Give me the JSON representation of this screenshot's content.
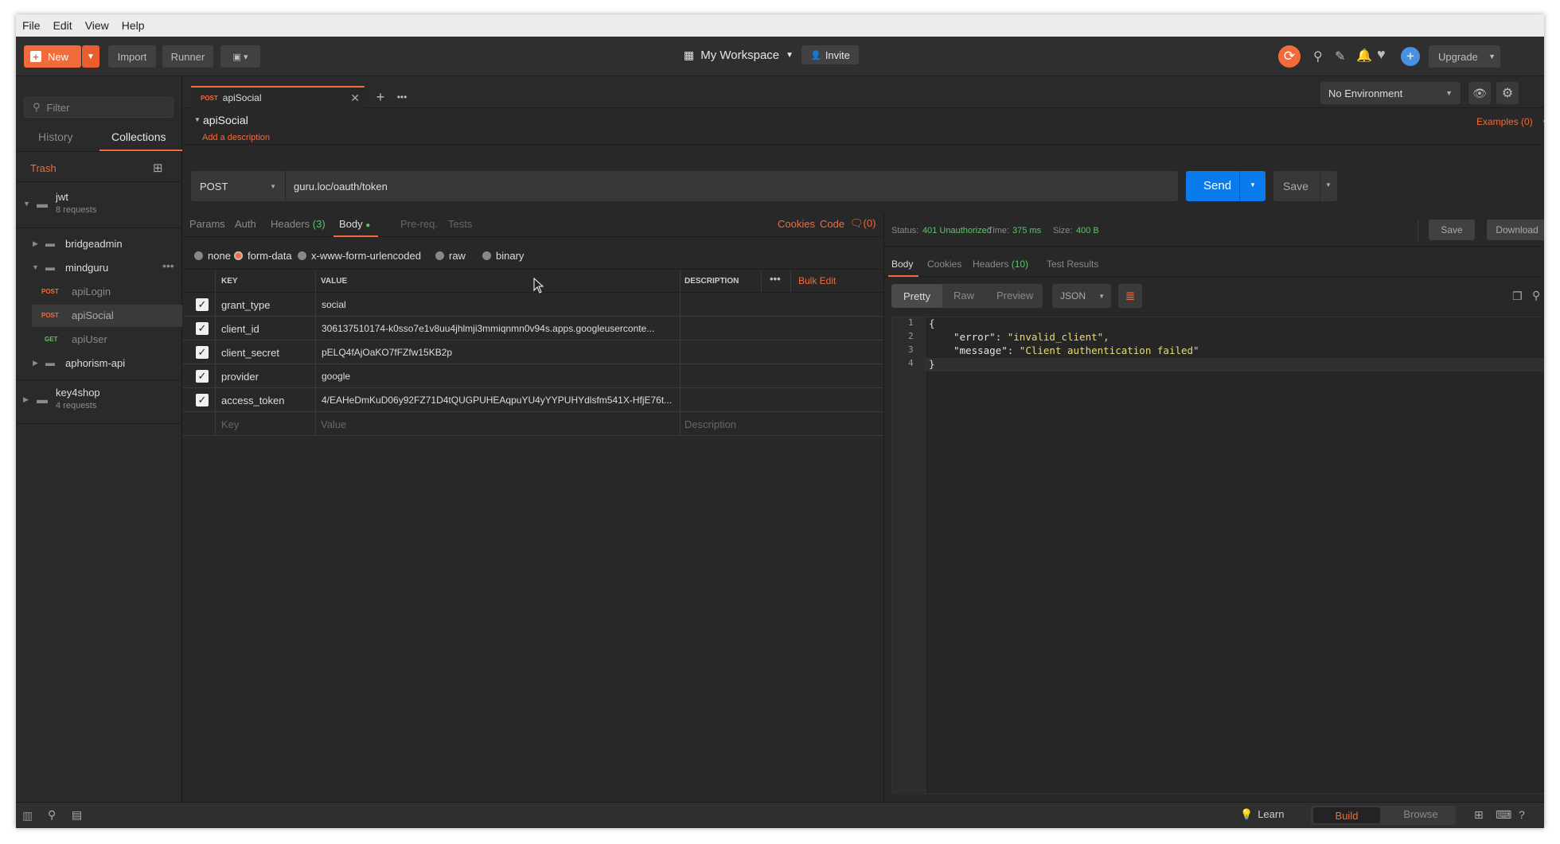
{
  "menu": [
    "File",
    "Edit",
    "View",
    "Help"
  ],
  "header": {
    "new_label": "New",
    "import_label": "Import",
    "runner_label": "Runner",
    "workspace": "My Workspace",
    "invite": "Invite",
    "upgrade": "Upgrade"
  },
  "sidebar": {
    "filter_placeholder": "Filter",
    "tabs": [
      "History",
      "Collections"
    ],
    "trash": "Trash",
    "collections": [
      {
        "name": "jwt",
        "count": "8 requests"
      },
      {
        "name": "key4shop",
        "count": "4 requests"
      }
    ],
    "folders": [
      "bridgeadmin",
      "mindguru",
      "aphorism-api"
    ],
    "requests": [
      {
        "method": "POST",
        "name": "apiLogin"
      },
      {
        "method": "POST",
        "name": "apiSocial"
      },
      {
        "method": "GET",
        "name": "apiUser"
      }
    ]
  },
  "tab": {
    "method": "POST",
    "name": "apiSocial"
  },
  "environment": "No Environment",
  "request": {
    "name": "apiSocial",
    "add_description": "Add a description",
    "examples": "Examples (0)",
    "method": "POST",
    "url": "guru.loc/oauth/token",
    "send": "Send",
    "save": "Save",
    "tabs": {
      "params": "Params",
      "auth": "Auth",
      "headers": "Headers",
      "headers_count": "(3)",
      "body": "Body",
      "prereq": "Pre-req.",
      "tests": "Tests"
    },
    "links": {
      "cookies": "Cookies",
      "code": "Code",
      "comments": "(0)"
    },
    "body_types": [
      "none",
      "form-data",
      "x-www-form-urlencoded",
      "raw",
      "binary"
    ],
    "columns": {
      "key": "KEY",
      "value": "VALUE",
      "description": "DESCRIPTION",
      "bulk": "Bulk Edit"
    },
    "rows": [
      {
        "key": "grant_type",
        "value": "social"
      },
      {
        "key": "client_id",
        "value": "306137510174-k0sso7e1v8uu4jhlmji3mmiqnmn0v94s.apps.googleuserconte..."
      },
      {
        "key": "client_secret",
        "value": "pELQ4fAjOaKO7fFZfw15KB2p"
      },
      {
        "key": "provider",
        "value": "google"
      },
      {
        "key": "access_token",
        "value": "4/EAHeDmKuD06y92FZ71D4tQUGPUHEAqpuYU4yYYPUHYdlsfm541X-HfjE76t..."
      }
    ],
    "placeholders": {
      "key": "Key",
      "value": "Value",
      "description": "Description"
    }
  },
  "response": {
    "status_label": "Status:",
    "status": "401 Unauthorized",
    "time_label": "Time:",
    "time": "375 ms",
    "size_label": "Size:",
    "size": "400 B",
    "save": "Save",
    "download": "Download",
    "tabs": {
      "body": "Body",
      "cookies": "Cookies",
      "headers": "Headers",
      "headers_count": "(10)",
      "tests": "Test Results"
    },
    "views": [
      "Pretty",
      "Raw",
      "Preview"
    ],
    "format": "JSON",
    "lines": [
      {
        "n": "1",
        "t": "{"
      },
      {
        "n": "2",
        "k": "\"error\"",
        "v": "\"invalid_client\","
      },
      {
        "n": "3",
        "k": "\"message\"",
        "v": "\"Client authentication failed\""
      },
      {
        "n": "4",
        "t": "}"
      }
    ]
  },
  "footer": {
    "learn": "Learn",
    "build": "Build",
    "browse": "Browse"
  },
  "colors": {
    "accent": "#f26b3a",
    "send": "#097bed",
    "status": "#5bc46a"
  }
}
